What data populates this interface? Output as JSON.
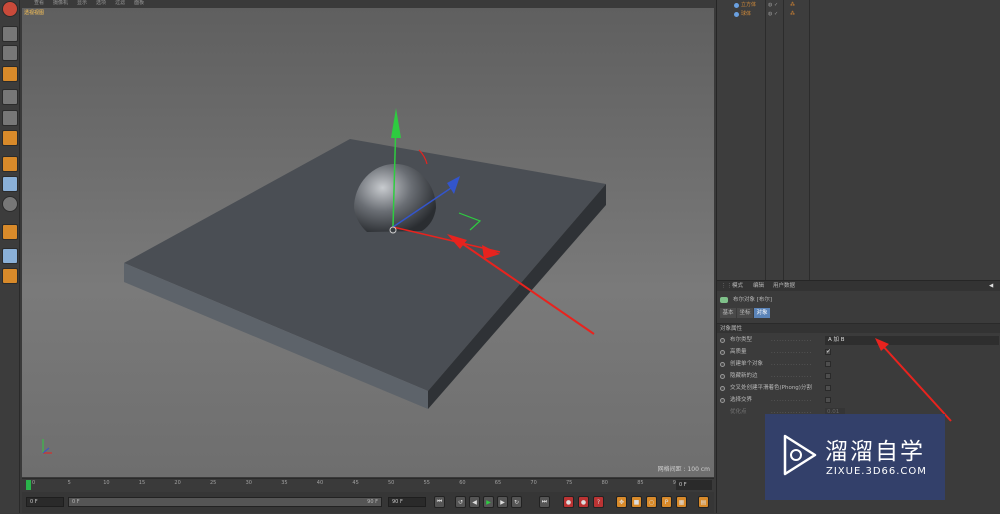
{
  "menu": [
    "查看",
    "摄像机",
    "显示",
    "选项",
    "过滤",
    "面板"
  ],
  "viewport": {
    "label": "透视视图",
    "scale_info": "网格间距 : 100 cm"
  },
  "timeline": {
    "ticks": [
      "0",
      "5",
      "10",
      "15",
      "20",
      "25",
      "30",
      "35",
      "40",
      "45",
      "50",
      "55",
      "60",
      "65",
      "70",
      "75",
      "80",
      "85",
      "90"
    ],
    "end_field": "0 F"
  },
  "controls": {
    "start_field": "0 F",
    "range_start": "0 F",
    "range_end": "90 F",
    "end_field": "90 F"
  },
  "objects": [
    {
      "name": "立方体"
    },
    {
      "name": "球体"
    }
  ],
  "attributes": {
    "tabs": [
      "模式",
      "编辑",
      "用户数据"
    ],
    "object_title": "布尔对象 [布尔]",
    "subtabs": [
      "基本",
      "坐标",
      "对象"
    ],
    "section": "对象属性",
    "rows": [
      {
        "label": "布尔类型",
        "value": "A 加 B"
      },
      {
        "label": "高质量",
        "checked": true
      },
      {
        "label": "创建单个对象",
        "checked": false
      },
      {
        "label": "隐藏新的边",
        "checked": false
      },
      {
        "label": "交叉处创建平滑着色(Phong)分割",
        "checked": false
      },
      {
        "label": "选择交界",
        "checked": false
      },
      {
        "label": "优化点",
        "value": "0.01"
      }
    ]
  },
  "watermark": {
    "title": "溜溜自学",
    "url": "ZIXUE.3D66.COM"
  },
  "colors": {
    "accent": "#d88a2a",
    "arrow": "#e8231e",
    "viewport_label": "#ffc658"
  }
}
